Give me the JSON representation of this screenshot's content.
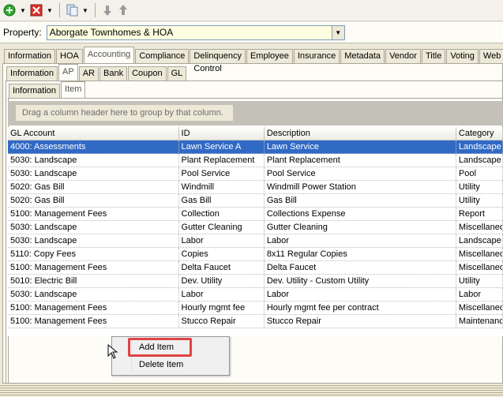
{
  "toolbar": {
    "icons": [
      "add-icon",
      "delete-icon",
      "copy-icon",
      "move-down-icon",
      "move-up-icon"
    ]
  },
  "property": {
    "label": "Property:",
    "value": "Aborgate Townhomes & HOA"
  },
  "main_tabs": [
    "Information",
    "HOA",
    "Accounting",
    "Compliance",
    "Delinquency Control",
    "Employee",
    "Insurance",
    "Metadata",
    "Vendor",
    "Title",
    "Voting",
    "Web"
  ],
  "main_active": "Accounting",
  "sub_tabs": [
    "Information",
    "AP",
    "AR",
    "Bank",
    "Coupon",
    "GL"
  ],
  "sub_active": "AP",
  "inner_tabs": [
    "Information",
    "Item"
  ],
  "inner_active": "Item",
  "group_prompt": "Drag a column header here to group by that column.",
  "columns": [
    "GL Account",
    "ID",
    "Description",
    "Category"
  ],
  "rows": [
    [
      "4000: Assessments",
      "Lawn Service A",
      "Lawn Service",
      "Landscape"
    ],
    [
      "5030: Landscape",
      "Plant Replacement",
      "Plant Replacement",
      "Landscape"
    ],
    [
      "5030: Landscape",
      "Pool Service",
      "Pool Service",
      "Pool"
    ],
    [
      "5020: Gas Bill",
      "Windmill",
      "Windmill Power Station",
      "Utility"
    ],
    [
      "5020: Gas Bill",
      "Gas Bill",
      "Gas Bill",
      "Utility"
    ],
    [
      "5100: Management Fees",
      "Collection",
      "Collections Expense",
      "Report"
    ],
    [
      "5030: Landscape",
      "Gutter Cleaning",
      "Gutter Cleaning",
      "Miscellaneous"
    ],
    [
      "5030: Landscape",
      "Labor",
      "Labor",
      "Landscape"
    ],
    [
      "5110: Copy Fees",
      "Copies",
      "8x11 Regular Copies",
      "Miscellaneous"
    ],
    [
      "5100: Management Fees",
      "Delta Faucet",
      "Delta Faucet",
      "Miscellaneous"
    ],
    [
      "5010: Electric Bill",
      "Dev. Utility",
      "Dev. Utility - Custom Utility",
      "Utility"
    ],
    [
      "5030: Landscape",
      "Labor",
      "Labor",
      "Labor"
    ],
    [
      "5100: Management Fees",
      "Hourly mgmt fee",
      "Hourly mgmt fee per contract",
      "Miscellaneous"
    ],
    [
      "5100: Management Fees",
      "Stucco Repair",
      "Stucco Repair",
      "Maintenance"
    ]
  ],
  "context_menu": {
    "items": [
      "Add Item",
      "Delete Item"
    ],
    "highlighted": "Add Item"
  },
  "colors": {
    "selection": "#316ac5",
    "highlight": "#e04343"
  }
}
